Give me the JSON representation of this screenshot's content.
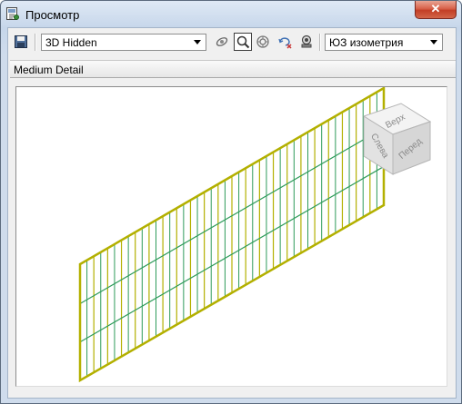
{
  "window": {
    "title": "Просмотр",
    "close_label": "✕"
  },
  "toolbar": {
    "visual_style": "3D Hidden",
    "view_preset": "ЮЗ изометрия",
    "icons": [
      "save-icon",
      "orbit-icon",
      "zoom-icon",
      "zoom-extents-icon",
      "rotate-icon",
      "camera-icon"
    ]
  },
  "detail_level": "Medium Detail",
  "viewcube": {
    "top": "Верх",
    "front": "Перед",
    "left": "Слева"
  },
  "colors": {
    "mesh_frame": "#b3b000",
    "mesh_bars": "#2e9b5a",
    "accent_close": "#c94a30"
  }
}
